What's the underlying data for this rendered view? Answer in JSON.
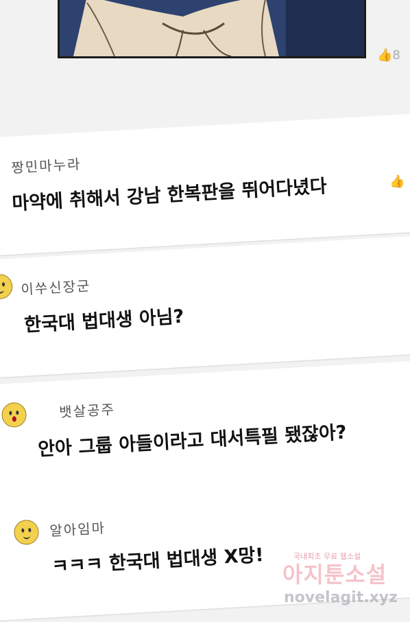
{
  "comments": [
    {
      "username": "짱민마누라",
      "text": "마약에 취해서 강남 한복판을 뛰어다녔다",
      "avatar": "none"
    },
    {
      "username": "이쑤신장군",
      "text": "한국대 법대생 아님?",
      "avatar": "smile"
    },
    {
      "username": "뱃살공주",
      "text": "안아 그룹 아들이라고 대서특필 됐잖아?",
      "avatar": "surprised"
    },
    {
      "username": "알아임마",
      "text": "ㅋㅋㅋ 한국대 법대생 X망!",
      "avatar": "smile"
    }
  ],
  "likes": {
    "first_count_fragment": "8"
  },
  "watermark": {
    "top": "국내최초 무료 웹소설",
    "main": "아지툰소설",
    "url": "novelagit.xyz"
  }
}
